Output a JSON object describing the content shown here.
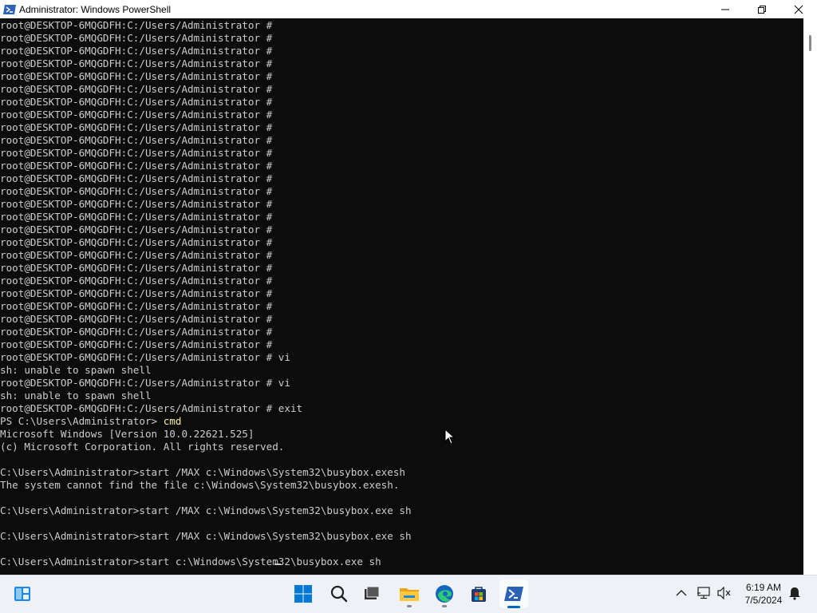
{
  "window": {
    "title": "Administrator: Windows PowerShell"
  },
  "console": {
    "lines": [
      {
        "text": "root@DESKTOP-6MQGDFH:C:/Users/Administrator #"
      },
      {
        "text": "root@DESKTOP-6MQGDFH:C:/Users/Administrator #"
      },
      {
        "text": "root@DESKTOP-6MQGDFH:C:/Users/Administrator #"
      },
      {
        "text": "root@DESKTOP-6MQGDFH:C:/Users/Administrator #"
      },
      {
        "text": "root@DESKTOP-6MQGDFH:C:/Users/Administrator #"
      },
      {
        "text": "root@DESKTOP-6MQGDFH:C:/Users/Administrator #"
      },
      {
        "text": "root@DESKTOP-6MQGDFH:C:/Users/Administrator #"
      },
      {
        "text": "root@DESKTOP-6MQGDFH:C:/Users/Administrator #"
      },
      {
        "text": "root@DESKTOP-6MQGDFH:C:/Users/Administrator #"
      },
      {
        "text": "root@DESKTOP-6MQGDFH:C:/Users/Administrator #"
      },
      {
        "text": "root@DESKTOP-6MQGDFH:C:/Users/Administrator #"
      },
      {
        "text": "root@DESKTOP-6MQGDFH:C:/Users/Administrator #"
      },
      {
        "text": "root@DESKTOP-6MQGDFH:C:/Users/Administrator #"
      },
      {
        "text": "root@DESKTOP-6MQGDFH:C:/Users/Administrator #"
      },
      {
        "text": "root@DESKTOP-6MQGDFH:C:/Users/Administrator #"
      },
      {
        "text": "root@DESKTOP-6MQGDFH:C:/Users/Administrator #"
      },
      {
        "text": "root@DESKTOP-6MQGDFH:C:/Users/Administrator #"
      },
      {
        "text": "root@DESKTOP-6MQGDFH:C:/Users/Administrator #"
      },
      {
        "text": "root@DESKTOP-6MQGDFH:C:/Users/Administrator #"
      },
      {
        "text": "root@DESKTOP-6MQGDFH:C:/Users/Administrator #"
      },
      {
        "text": "root@DESKTOP-6MQGDFH:C:/Users/Administrator #"
      },
      {
        "text": "root@DESKTOP-6MQGDFH:C:/Users/Administrator #"
      },
      {
        "text": "root@DESKTOP-6MQGDFH:C:/Users/Administrator #"
      },
      {
        "text": "root@DESKTOP-6MQGDFH:C:/Users/Administrator #"
      },
      {
        "text": "root@DESKTOP-6MQGDFH:C:/Users/Administrator #"
      },
      {
        "text": "root@DESKTOP-6MQGDFH:C:/Users/Administrator #"
      },
      {
        "text": "root@DESKTOP-6MQGDFH:C:/Users/Administrator # vi"
      },
      {
        "text": "sh: unable to spawn shell"
      },
      {
        "text": "root@DESKTOP-6MQGDFH:C:/Users/Administrator # vi"
      },
      {
        "text": "sh: unable to spawn shell"
      },
      {
        "text": "root@DESKTOP-6MQGDFH:C:/Users/Administrator # exit"
      },
      {
        "text": "PS C:\\Users\\Administrator> ",
        "cmd": "cmd"
      },
      {
        "text": "Microsoft Windows [Version 10.0.22621.525]"
      },
      {
        "text": "(c) Microsoft Corporation. All rights reserved."
      },
      {
        "text": ""
      },
      {
        "text": "C:\\Users\\Administrator>start /MAX c:\\Windows\\System32\\busybox.exesh"
      },
      {
        "text": "The system cannot find the file c:\\Windows\\System32\\busybox.exesh."
      },
      {
        "text": ""
      },
      {
        "text": "C:\\Users\\Administrator>start /MAX c:\\Windows\\System32\\busybox.exe sh"
      },
      {
        "text": ""
      },
      {
        "text": "C:\\Users\\Administrator>start /MAX c:\\Windows\\System32\\busybox.exe sh"
      },
      {
        "text": ""
      },
      {
        "text": "C:\\Users\\Administrator>start c:\\Windows\\System32\\busybox.exe sh"
      }
    ]
  },
  "taskbar": {
    "items": [
      {
        "name": "widgets-icon"
      },
      {
        "name": "start-icon"
      },
      {
        "name": "search-icon"
      },
      {
        "name": "task-view-icon"
      },
      {
        "name": "file-explorer-icon"
      },
      {
        "name": "edge-icon"
      },
      {
        "name": "store-icon"
      },
      {
        "name": "powershell-icon"
      }
    ],
    "clock": {
      "time": "6:19 AM",
      "date": "7/5/2024"
    }
  },
  "colors": {
    "console_bg": "#0c0c0c",
    "console_text": "#cccccc",
    "command_highlight": "#f9f1a5",
    "accent": "#0067c0"
  }
}
